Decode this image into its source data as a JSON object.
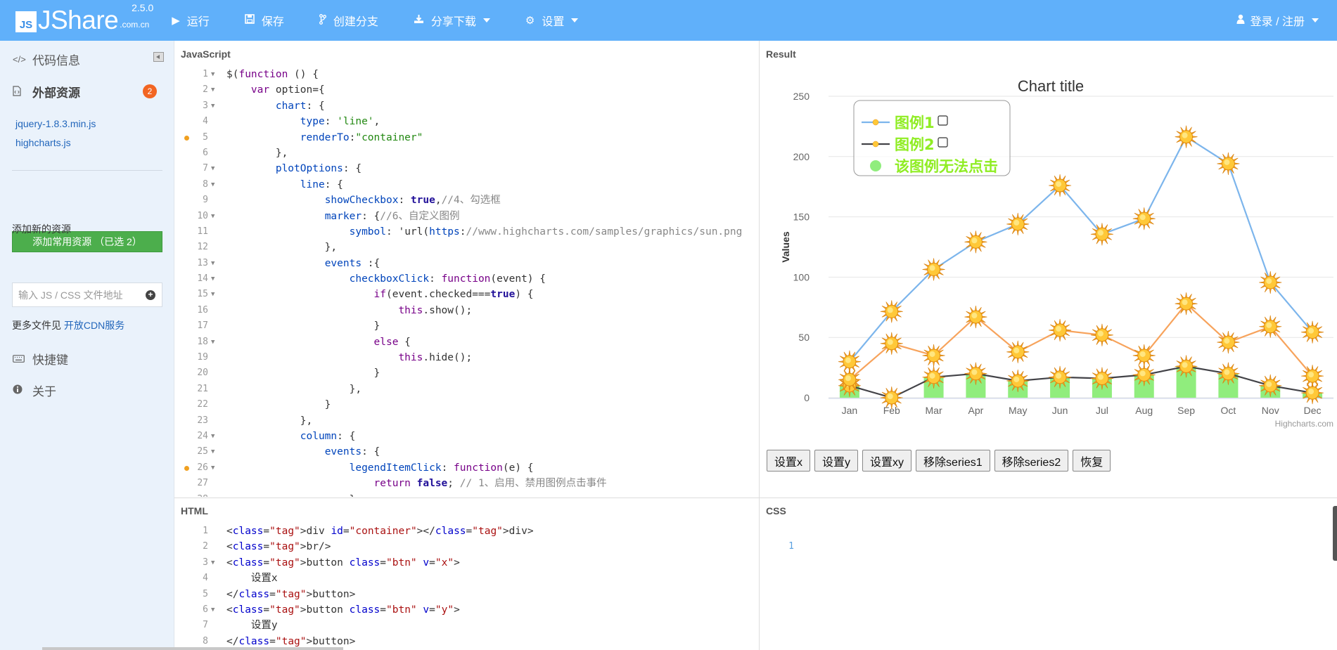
{
  "app": {
    "logo_mark": "JS",
    "logo_name": "JShare",
    "logo_domain": ".com.cn",
    "version": "2.5.0"
  },
  "nav": {
    "run": "运行",
    "save": "保存",
    "branch": "创建分支",
    "share": "分享下载",
    "settings": "设置",
    "login": "登录 / 注册"
  },
  "sidebar": {
    "code_info": "代码信息",
    "external_resources": "外部资源",
    "resource_count": "2",
    "resources": [
      "jquery-1.8.3.min.js",
      "highcharts.js"
    ],
    "add_common": "添加常用资源 （已选 2）",
    "add_new": "添加新的资源",
    "input_placeholder": "输入 JS / CSS 文件地址",
    "more_files_prefix": "更多文件见",
    "cdn_link": "开放CDN服务",
    "shortcuts": "快捷键",
    "about": "关于"
  },
  "panes": {
    "javascript": "JavaScript",
    "result": "Result",
    "html": "HTML",
    "css": "CSS"
  },
  "js_code": [
    "$(function () {",
    "    var option={",
    "        chart: {",
    "            type: 'line',",
    "            renderTo:\"container\"",
    "        },",
    "        plotOptions: {",
    "            line: {",
    "                showCheckbox: true,//4、勾选框",
    "                marker: {//6、自定义图例",
    "                    symbol: 'url(https://www.highcharts.com/samples/graphics/sun.png",
    "                },",
    "                events :{",
    "                    checkboxClick: function(event) {",
    "                        if(event.checked===true) {",
    "                            this.show();",
    "                        }",
    "                        else {",
    "                            this.hide();",
    "                        }",
    "                    },",
    "                }",
    "            },",
    "            column: {",
    "                events: {",
    "                    legendItemClick: function(e) {",
    "                        return false; // 1、启用、禁用图例点击事件",
    "                    }"
  ],
  "html_code": [
    "<div id=\"container\"></div>",
    "<br/>",
    "<button class=\"btn\" v=\"x\">",
    "    设置x",
    "</button>",
    "<button class=\"btn\" v=\"y\">",
    "    设置y",
    "</button>"
  ],
  "css_code": [
    "1"
  ],
  "chart_data": {
    "type": "line",
    "title": "Chart title",
    "ylabel": "Values",
    "credits": "Highcharts.com",
    "categories": [
      "Jan",
      "Feb",
      "Mar",
      "Apr",
      "May",
      "Jun",
      "Jul",
      "Aug",
      "Sep",
      "Oct",
      "Nov",
      "Dec"
    ],
    "ylim": [
      0,
      250
    ],
    "yticks": [
      0,
      50,
      100,
      150,
      200,
      250
    ],
    "grid": true,
    "legend_position": "top-left",
    "series": [
      {
        "name": "图例1",
        "type": "line",
        "color": "#7cb5ec",
        "values": [
          29.9,
          71.5,
          106.4,
          129.2,
          144.0,
          176.0,
          135.6,
          148.5,
          216.4,
          194.1,
          95.6,
          54.4
        ]
      },
      {
        "name": "图例2",
        "type": "line",
        "color": "#434348",
        "values": [
          10,
          0,
          17,
          20,
          14,
          17,
          16,
          19,
          26,
          20,
          10,
          4
        ]
      },
      {
        "name": "",
        "type": "line",
        "color": "#f7a35c",
        "values": [
          15,
          45,
          35,
          67,
          38,
          56,
          52,
          35,
          78,
          46,
          59,
          18
        ]
      },
      {
        "name": "该图例无法点击",
        "type": "column",
        "color": "#90ed7d",
        "values": [
          10,
          0,
          17,
          20,
          14,
          17,
          16,
          19,
          26,
          20,
          10,
          4
        ]
      }
    ]
  },
  "controls": [
    "设置x",
    "设置y",
    "设置xy",
    "移除series1",
    "移除series2",
    "恢复"
  ]
}
